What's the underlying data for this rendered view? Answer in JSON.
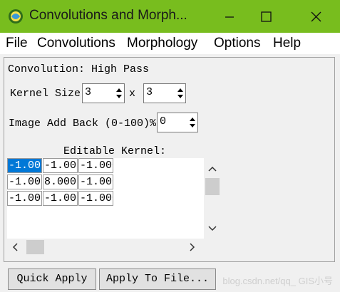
{
  "window": {
    "title": "Convolutions and Morph..."
  },
  "menu": [
    "File",
    "Convolutions",
    "Morphology",
    "Options",
    "Help"
  ],
  "panel": {
    "convolution_label": "Convolution: High Pass",
    "kernel_size_label": "Kernel Size",
    "kernel_rows": "3",
    "kernel_x": "x",
    "kernel_cols": "3",
    "add_back_label": "Image Add Back (0-100)%",
    "add_back_value": "0",
    "editable_kernel_label": "Editable Kernel:",
    "kernel": [
      [
        "-1.000",
        "-1.000",
        "-1.000"
      ],
      [
        "-1.000",
        "8.000",
        "-1.000"
      ],
      [
        "-1.000",
        "-1.000",
        "-1.000"
      ]
    ]
  },
  "buttons": {
    "quick_apply": "Quick Apply",
    "apply_to_file": "Apply To File..."
  },
  "watermark": "blog.csdn.net/qq_ GIS小号",
  "colors": {
    "titlebar": "#78bd1e",
    "selection": "#0078d7"
  }
}
